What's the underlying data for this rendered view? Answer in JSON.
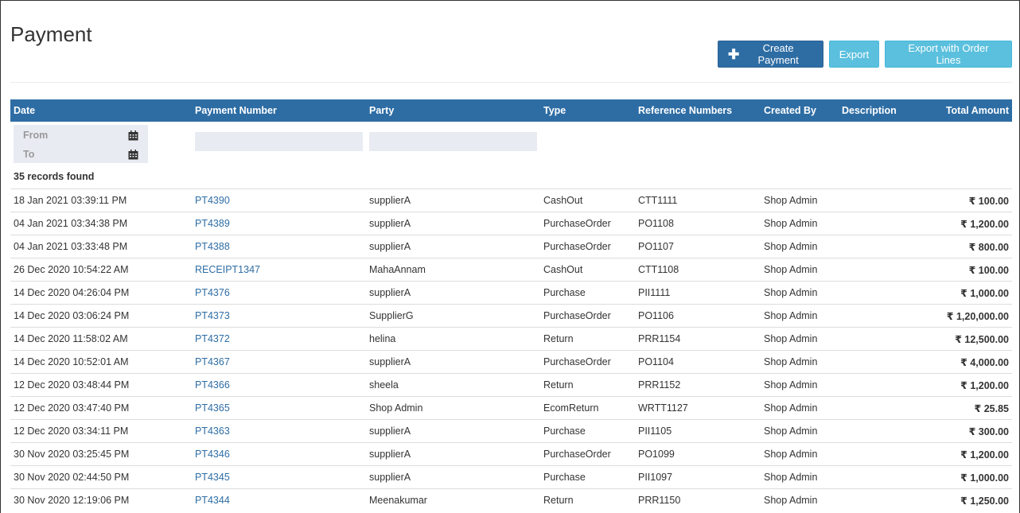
{
  "page": {
    "title": "Payment"
  },
  "toolbar": {
    "create_label": "Create Payment",
    "export_label": "Export",
    "export_lines_label": "Export with Order Lines"
  },
  "colors": {
    "header_bg": "#2e6da4",
    "link": "#2e6da4",
    "info_button": "#5bc0de"
  },
  "table": {
    "columns": [
      "Date",
      "Payment Number",
      "Party",
      "Type",
      "Reference Numbers",
      "Created By",
      "Description",
      "Total Amount"
    ],
    "filters": {
      "from_placeholder": "From",
      "to_placeholder": "To"
    },
    "records_found": "35 records found",
    "rows": [
      {
        "date": "18 Jan 2021 03:39:11 PM",
        "number": "PT4390",
        "party": "supplierA",
        "type": "CashOut",
        "ref": "CTT1111",
        "created_by": "Shop Admin",
        "description": "",
        "amount": "₹ 100.00"
      },
      {
        "date": "04 Jan 2021 03:34:38 PM",
        "number": "PT4389",
        "party": "supplierA",
        "type": "PurchaseOrder",
        "ref": "PO1108",
        "created_by": "Shop Admin",
        "description": "",
        "amount": "₹ 1,200.00"
      },
      {
        "date": "04 Jan 2021 03:33:48 PM",
        "number": "PT4388",
        "party": "supplierA",
        "type": "PurchaseOrder",
        "ref": "PO1107",
        "created_by": "Shop Admin",
        "description": "",
        "amount": "₹ 800.00"
      },
      {
        "date": "26 Dec 2020 10:54:22 AM",
        "number": "RECEIPT1347",
        "party": "MahaAnnam",
        "type": "CashOut",
        "ref": "CTT1108",
        "created_by": "Shop Admin",
        "description": "",
        "amount": "₹ 100.00"
      },
      {
        "date": "14 Dec 2020 04:26:04 PM",
        "number": "PT4376",
        "party": "supplierA",
        "type": "Purchase",
        "ref": "PII1111",
        "created_by": "Shop Admin",
        "description": "",
        "amount": "₹ 1,000.00"
      },
      {
        "date": "14 Dec 2020 03:06:24 PM",
        "number": "PT4373",
        "party": "SupplierG",
        "type": "PurchaseOrder",
        "ref": "PO1106",
        "created_by": "Shop Admin",
        "description": "",
        "amount": "₹ 1,20,000.00"
      },
      {
        "date": "14 Dec 2020 11:58:02 AM",
        "number": "PT4372",
        "party": "helina",
        "type": "Return",
        "ref": "PRR1154",
        "created_by": "Shop Admin",
        "description": "",
        "amount": "₹ 12,500.00"
      },
      {
        "date": "14 Dec 2020 10:52:01 AM",
        "number": "PT4367",
        "party": "supplierA",
        "type": "PurchaseOrder",
        "ref": "PO1104",
        "created_by": "Shop Admin",
        "description": "",
        "amount": "₹ 4,000.00"
      },
      {
        "date": "12 Dec 2020 03:48:44 PM",
        "number": "PT4366",
        "party": "sheela",
        "type": "Return",
        "ref": "PRR1152",
        "created_by": "Shop Admin",
        "description": "",
        "amount": "₹ 1,200.00"
      },
      {
        "date": "12 Dec 2020 03:47:40 PM",
        "number": "PT4365",
        "party": "Shop Admin",
        "type": "EcomReturn",
        "ref": "WRTT1127",
        "created_by": "Shop Admin",
        "description": "",
        "amount": "₹ 25.85"
      },
      {
        "date": "12 Dec 2020 03:34:11 PM",
        "number": "PT4363",
        "party": "supplierA",
        "type": "Purchase",
        "ref": "PII1105",
        "created_by": "Shop Admin",
        "description": "",
        "amount": "₹ 300.00"
      },
      {
        "date": "30 Nov 2020 03:25:45 PM",
        "number": "PT4346",
        "party": "supplierA",
        "type": "PurchaseOrder",
        "ref": "PO1099",
        "created_by": "Shop Admin",
        "description": "",
        "amount": "₹ 1,200.00"
      },
      {
        "date": "30 Nov 2020 02:44:50 PM",
        "number": "PT4345",
        "party": "supplierA",
        "type": "Purchase",
        "ref": "PII1097",
        "created_by": "Shop Admin",
        "description": "",
        "amount": "₹ 1,000.00"
      },
      {
        "date": "30 Nov 2020 12:19:06 PM",
        "number": "PT4344",
        "party": "Meenakumar",
        "type": "Return",
        "ref": "PRR1150",
        "created_by": "Shop Admin",
        "description": "",
        "amount": "₹ 1,250.00"
      }
    ]
  }
}
